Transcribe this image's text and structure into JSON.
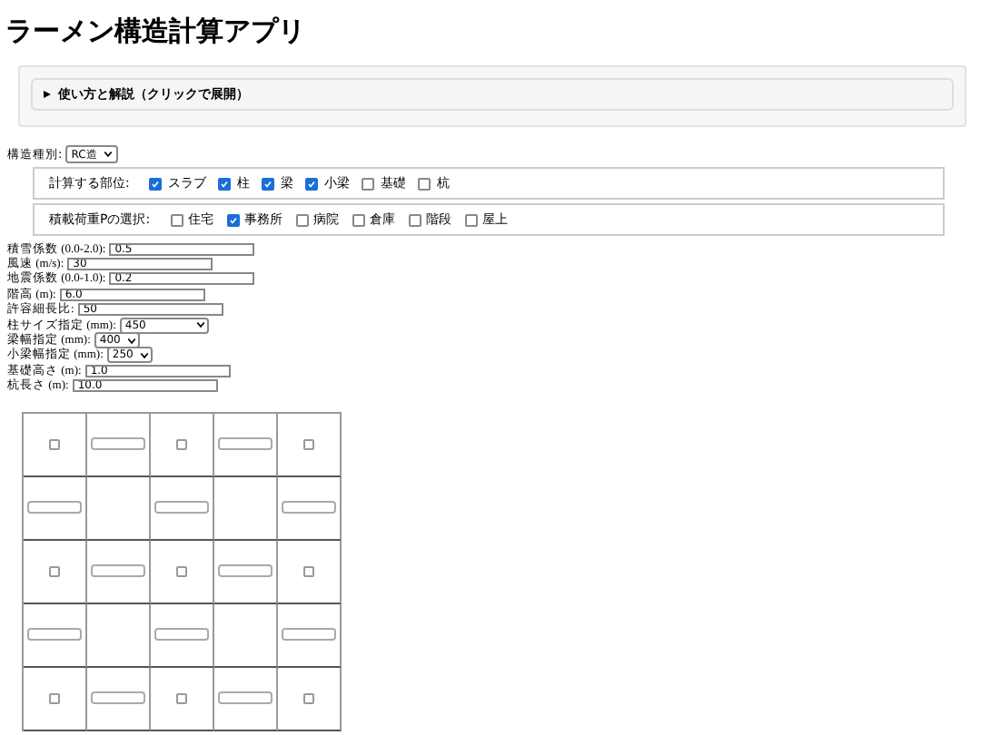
{
  "title": "ラーメン構造計算アプリ",
  "help": {
    "label": "使い方と解説（クリックで展開）",
    "expanded": false
  },
  "structure_type": {
    "label": "構造種別:",
    "value": "RC造"
  },
  "members": {
    "label": "計算する部位:",
    "options": [
      {
        "label": "スラブ",
        "checked": true
      },
      {
        "label": "柱",
        "checked": true
      },
      {
        "label": "梁",
        "checked": true
      },
      {
        "label": "小梁",
        "checked": true
      },
      {
        "label": "基礎",
        "checked": false
      },
      {
        "label": "杭",
        "checked": false
      }
    ]
  },
  "live_load": {
    "label": "積載荷重Pの選択:",
    "options": [
      {
        "label": "住宅",
        "checked": false
      },
      {
        "label": "事務所",
        "checked": true
      },
      {
        "label": "病院",
        "checked": false
      },
      {
        "label": "倉庫",
        "checked": false
      },
      {
        "label": "階段",
        "checked": false
      },
      {
        "label": "屋上",
        "checked": false
      }
    ]
  },
  "fields": [
    {
      "kind": "input",
      "label": "積雪係数 (0.0-2.0):",
      "value": "0.5"
    },
    {
      "kind": "input",
      "label": "風速 (m/s):",
      "value": "30"
    },
    {
      "kind": "input",
      "label": "地震係数 (0.0-1.0):",
      "value": "0.2"
    },
    {
      "kind": "input",
      "label": "階高 (m):",
      "value": "6.0"
    },
    {
      "kind": "input",
      "label": "許容細長比:",
      "value": "50"
    },
    {
      "kind": "select",
      "label": "柱サイズ指定 (mm):",
      "value": "450",
      "wide": true
    },
    {
      "kind": "select",
      "label": "梁幅指定 (mm):",
      "value": "400",
      "wide": false
    },
    {
      "kind": "select",
      "label": "小梁幅指定 (mm):",
      "value": "250",
      "wide": false
    },
    {
      "kind": "input",
      "label": "基礎高さ (m):",
      "value": "1.0"
    },
    {
      "kind": "input",
      "label": "杭長さ (m):",
      "value": "10.0"
    }
  ],
  "grid": [
    [
      {
        "kind": "node",
        "checked": false
      },
      {
        "kind": "span"
      },
      {
        "kind": "node",
        "checked": false
      },
      {
        "kind": "span"
      },
      {
        "kind": "node",
        "checked": false
      }
    ],
    [
      {
        "kind": "span"
      },
      {
        "kind": "empty"
      },
      {
        "kind": "span"
      },
      {
        "kind": "empty"
      },
      {
        "kind": "span"
      }
    ],
    [
      {
        "kind": "node",
        "checked": false
      },
      {
        "kind": "span"
      },
      {
        "kind": "node",
        "checked": false
      },
      {
        "kind": "span"
      },
      {
        "kind": "node",
        "checked": false
      }
    ],
    [
      {
        "kind": "span"
      },
      {
        "kind": "empty"
      },
      {
        "kind": "span"
      },
      {
        "kind": "empty"
      },
      {
        "kind": "span"
      }
    ],
    [
      {
        "kind": "node",
        "checked": false
      },
      {
        "kind": "span"
      },
      {
        "kind": "node",
        "checked": false
      },
      {
        "kind": "span"
      },
      {
        "kind": "node",
        "checked": false
      }
    ]
  ]
}
